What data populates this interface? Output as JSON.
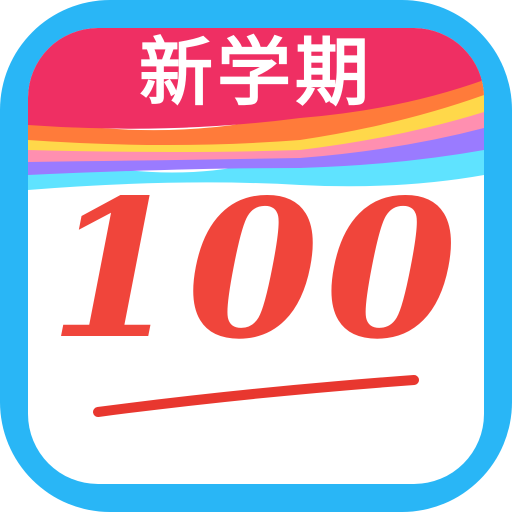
{
  "app_icon": {
    "banner_text": "新学期",
    "score": "100",
    "colors": {
      "frame": "#29b6f6",
      "card": "#ffffff",
      "banner": "#ef2f63",
      "score": "#f0453b",
      "underline": "#e8372f",
      "ribbon_yellow": "#ffd84a",
      "ribbon_pink": "#ff8fb0",
      "ribbon_orange": "#ff7b3a",
      "ribbon_purple": "#9a7bff",
      "ribbon_cyan": "#5fe3ff"
    }
  }
}
